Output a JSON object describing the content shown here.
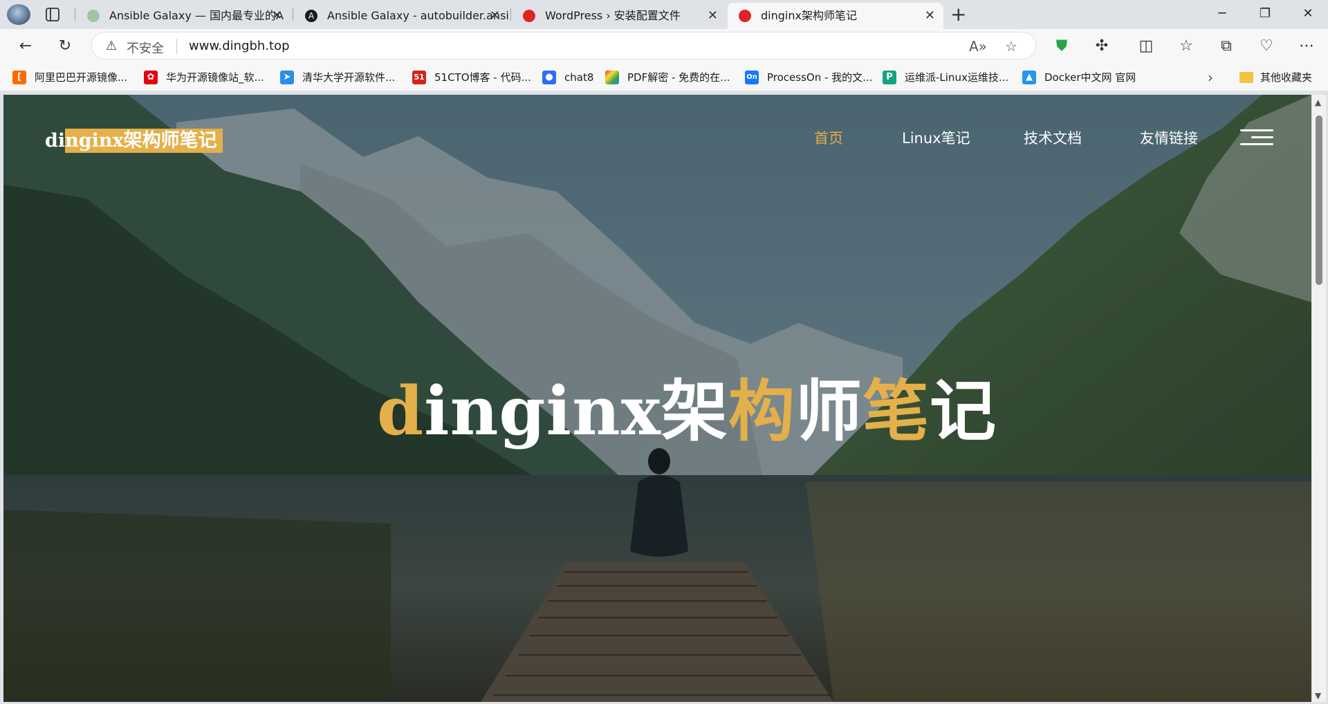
{
  "browser": {
    "tabs": [
      {
        "title": "Ansible Galaxy — 国内最专业的A",
        "active": false
      },
      {
        "title": "Ansible Galaxy - autobuilder.ansi",
        "active": false
      },
      {
        "title": "WordPress › 安装配置文件",
        "active": false
      },
      {
        "title": "dinginx架构师笔记",
        "active": true
      }
    ],
    "new_tab": "+",
    "address": {
      "security_label": "不安全",
      "url": "www.dingbh.top"
    },
    "bookmarks": [
      {
        "label": "阿里巴巴开源镜像...",
        "icon": "alibaba-icon",
        "color": "#ff6a00"
      },
      {
        "label": "华为开源镜像站_软...",
        "icon": "huawei-icon",
        "color": "#e60012"
      },
      {
        "label": "清华大学开源软件...",
        "icon": "tsinghua-icon",
        "color": "#2b8de8"
      },
      {
        "label": "51CTO博客 - 代码...",
        "icon": "51cto-icon",
        "color": "#d6221a"
      },
      {
        "label": "chat8",
        "icon": "chat-icon",
        "color": "#2f6bff"
      },
      {
        "label": "PDF解密 - 免费的在...",
        "icon": "pdf-icon",
        "color": "#f2a500"
      },
      {
        "label": "ProcessOn - 我的文...",
        "icon": "processon-icon",
        "color": "#1677ff"
      },
      {
        "label": "运维派-Linux运维技...",
        "icon": "yunweipai-icon",
        "color": "#14a37f"
      },
      {
        "label": "Docker中文网 官网",
        "icon": "docker-icon",
        "color": "#2496ed"
      }
    ],
    "other_bookmarks": "其他收藏夹"
  },
  "site": {
    "logo_plain": "di",
    "logo_highlight": "nginx架构师笔记",
    "nav": [
      {
        "label": "首页",
        "active": true
      },
      {
        "label": "Linux笔记",
        "active": false
      },
      {
        "label": "技术文档",
        "active": false
      },
      {
        "label": "友情链接",
        "active": false
      }
    ],
    "hero": {
      "p1": "d",
      "p2": "inginx架",
      "p3": "构",
      "p4": "师",
      "p5": "笔",
      "p6": "记"
    },
    "accent_color": "#e4b04a"
  }
}
